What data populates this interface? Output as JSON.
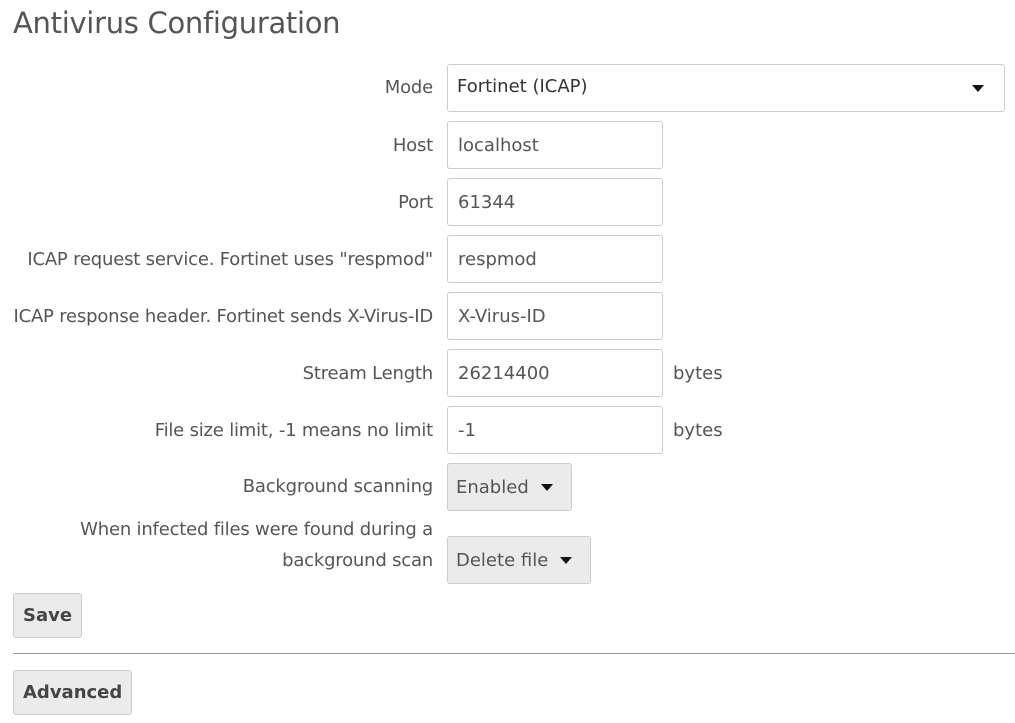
{
  "page": {
    "title": "Antivirus Configuration"
  },
  "form": {
    "mode": {
      "label": "Mode",
      "value": "Fortinet (ICAP)"
    },
    "host": {
      "label": "Host",
      "value": "localhost"
    },
    "port": {
      "label": "Port",
      "value": "61344"
    },
    "icap_request_service": {
      "label": "ICAP request service. Fortinet uses \"respmod\"",
      "value": "respmod"
    },
    "icap_response_header": {
      "label": "ICAP response header. Fortinet sends X-Virus-ID",
      "value": "X-Virus-ID"
    },
    "stream_length": {
      "label": "Stream Length",
      "value": "26214400",
      "unit": "bytes"
    },
    "file_size_limit": {
      "label": "File size limit, -1 means no limit",
      "value": "-1",
      "unit": "bytes"
    },
    "background_scanning": {
      "label": "Background scanning",
      "value": "Enabled"
    },
    "infected_action": {
      "label": "When infected files were found during a background scan",
      "value": "Delete file"
    }
  },
  "actions": {
    "save_label": "Save",
    "advanced_label": "Advanced"
  },
  "icons": {
    "dropdown": "caret-down-icon"
  }
}
